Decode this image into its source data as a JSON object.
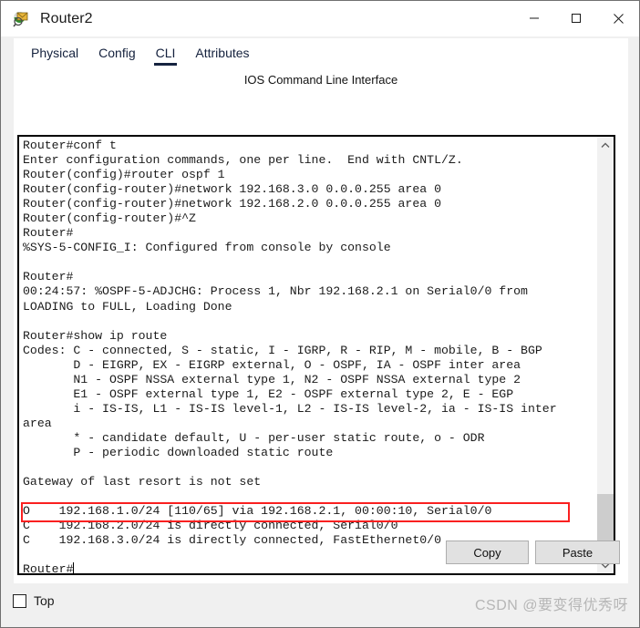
{
  "window": {
    "title": "Router2",
    "icon": "packet-tracer-router-icon",
    "controls": {
      "minimize": "minimize-icon",
      "maximize": "maximize-icon",
      "close": "close-icon"
    }
  },
  "tabs": [
    {
      "label": "Physical",
      "active": false
    },
    {
      "label": "Config",
      "active": false
    },
    {
      "label": "CLI",
      "active": true
    },
    {
      "label": "Attributes",
      "active": false
    }
  ],
  "panel": {
    "header": "IOS Command Line Interface"
  },
  "terminal": {
    "lines": [
      "Router#conf t",
      "Enter configuration commands, one per line.  End with CNTL/Z.",
      "Router(config)#router ospf 1",
      "Router(config-router)#network 192.168.3.0 0.0.0.255 area 0",
      "Router(config-router)#network 192.168.2.0 0.0.0.255 area 0",
      "Router(config-router)#^Z",
      "Router#",
      "%SYS-5-CONFIG_I: Configured from console by console",
      "",
      "Router#",
      "00:24:57: %OSPF-5-ADJCHG: Process 1, Nbr 192.168.2.1 on Serial0/0 from",
      "LOADING to FULL, Loading Done",
      "",
      "Router#show ip route",
      "Codes: C - connected, S - static, I - IGRP, R - RIP, M - mobile, B - BGP",
      "       D - EIGRP, EX - EIGRP external, O - OSPF, IA - OSPF inter area",
      "       N1 - OSPF NSSA external type 1, N2 - OSPF NSSA external type 2",
      "       E1 - OSPF external type 1, E2 - OSPF external type 2, E - EGP",
      "       i - IS-IS, L1 - IS-IS level-1, L2 - IS-IS level-2, ia - IS-IS inter",
      "area",
      "       * - candidate default, U - per-user static route, o - ODR",
      "       P - periodic downloaded static route",
      "",
      "Gateway of last resort is not set",
      "",
      "O    192.168.1.0/24 [110/65] via 192.168.2.1, 00:00:10, Serial0/0",
      "C    192.168.2.0/24 is directly connected, Serial0/0",
      "C    192.168.3.0/24 is directly connected, FastEthernet0/0",
      "",
      "Router#"
    ],
    "highlight_line": "O    192.168.1.0/24 [110/65] via 192.168.2.1, 00:00:10, Serial0/0",
    "highlight_color": "#fa2020",
    "prompt": "Router#"
  },
  "scrollbar": {
    "up_arrow": "chevron-up-icon",
    "down_arrow": "chevron-down-icon"
  },
  "buttons": {
    "copy": "Copy",
    "paste": "Paste"
  },
  "statusbar": {
    "top_checkbox_label": "Top",
    "top_checked": false,
    "watermark": "CSDN @要变得优秀呀"
  }
}
